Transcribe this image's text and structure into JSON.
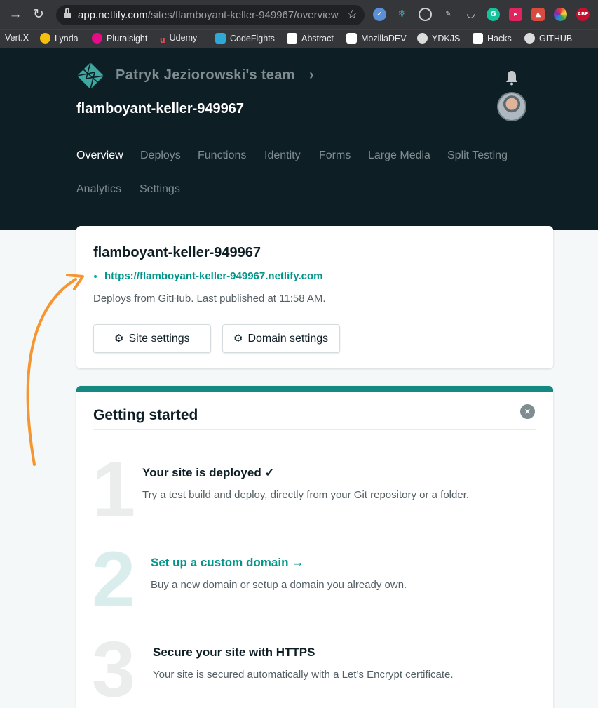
{
  "browser": {
    "url_host": "app.netlify.com",
    "url_path": "/sites/flamboyant-keller-949967/overview",
    "bookmarks": [
      "Vert.X",
      "Lynda",
      "Pluralsight",
      "Udemy",
      "CodeFights",
      "Abstract",
      "MozillaDEV",
      "YDKJS",
      "Hacks",
      "GITHUB"
    ],
    "ext_labels": [
      "ABP"
    ]
  },
  "header": {
    "team": "Patryk Jeziorowski's team",
    "site_name": "flamboyant-keller-949967",
    "tabs": [
      "Overview",
      "Deploys",
      "Functions",
      "Identity",
      "Forms",
      "Large Media",
      "Split Testing",
      "Analytics",
      "Settings"
    ]
  },
  "site_card": {
    "title": "flamboyant-keller-949967",
    "url": "https://flamboyant-keller-949967.netlify.com",
    "deploys_prefix": "Deploys from ",
    "deploys_source": "GitHub",
    "deploys_suffix": ". Last published at 11:58 AM.",
    "site_settings_label": "Site settings",
    "domain_settings_label": "Domain settings"
  },
  "getting_started": {
    "title": "Getting started",
    "steps": [
      {
        "number": "1",
        "title": "Your site is deployed ✓",
        "desc": "Try a test build and deploy, directly from your Git repository or a folder."
      },
      {
        "number": "2",
        "title": "Set up a custom domain →",
        "desc": "Buy a new domain or setup a domain you already own."
      },
      {
        "number": "3",
        "title": "Secure your site with HTTPS",
        "desc": "Your site is secured automatically with a Let’s Encrypt certificate."
      }
    ]
  },
  "colors": {
    "header_bg": "#0e1e25",
    "accent_teal": "#00968a",
    "annotation_orange": "#f7962e"
  }
}
